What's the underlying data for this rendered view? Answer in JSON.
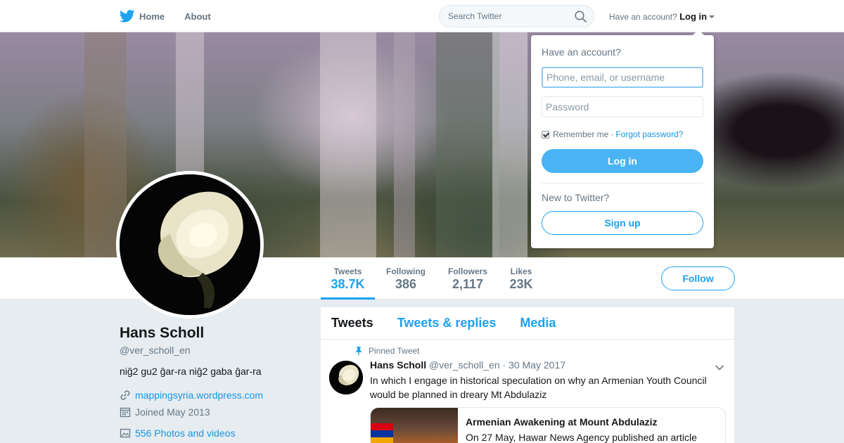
{
  "nav": {
    "home_label": "Home",
    "about_label": "About",
    "search_placeholder": "Search Twitter",
    "account_prompt": "Have an account?",
    "login_label": "Log in"
  },
  "login_dropdown": {
    "title": "Have an account?",
    "username_placeholder": "Phone, email, or username",
    "password_placeholder": "Password",
    "remember_label": "Remember me",
    "separator": "·",
    "forgot_label": "Forgot password?",
    "login_button": "Log in",
    "new_prompt": "New to Twitter?",
    "signup_button": "Sign up"
  },
  "profile_nav": {
    "stats": [
      {
        "label": "Tweets",
        "value": "38.7K"
      },
      {
        "label": "Following",
        "value": "386"
      },
      {
        "label": "Followers",
        "value": "2,117"
      },
      {
        "label": "Likes",
        "value": "23K"
      }
    ],
    "follow_button": "Follow"
  },
  "profile": {
    "name": "Hans Scholl",
    "handle": "@ver_scholl_en",
    "bio": "niĝ2 gu2 ĝar-ra niĝ2 gaba ĝar-ra",
    "website": "mappingsyria.wordpress.com",
    "joined": "Joined May 2013",
    "photos": "556 Photos and videos"
  },
  "timeline": {
    "tabs": [
      "Tweets",
      "Tweets & replies",
      "Media"
    ],
    "pinned_label": "Pinned Tweet",
    "tweet": {
      "author": "Hans Scholl",
      "handle": "@ver_scholl_en",
      "date": "· 30 May 2017",
      "text": "In which I engage in historical speculation on why an Armenian Youth Council would be planned in dreary Mt Abdulaziz",
      "card_title": "Armenian Awakening at Mount Abdulaziz",
      "card_desc": "On 27 May, Hawar News Agency published an article"
    }
  },
  "colors": {
    "accent": "#1da1f2",
    "login_button": "#4ab3f4",
    "background": "#e6ecf0"
  }
}
